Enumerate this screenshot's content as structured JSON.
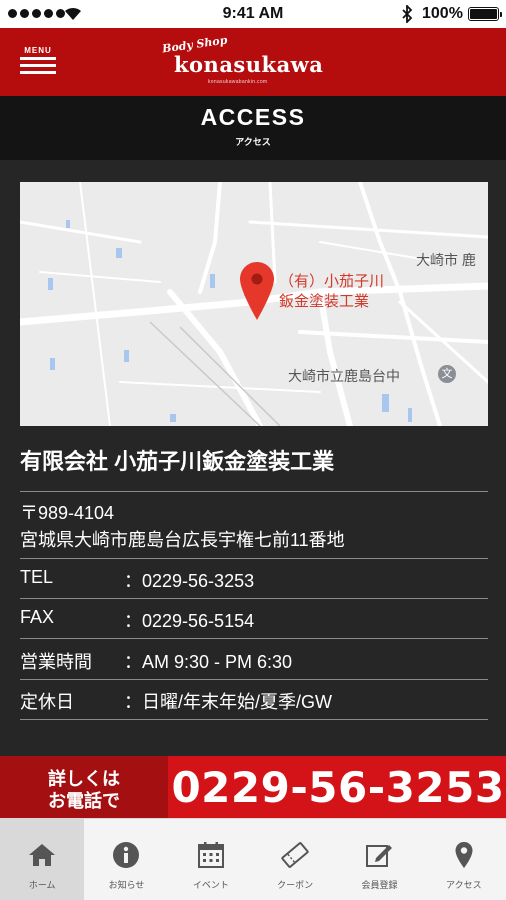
{
  "status_bar": {
    "time": "9:41 AM",
    "battery": "100%",
    "icons": [
      "signal-icon",
      "wifi-icon",
      "bluetooth-icon",
      "battery-icon"
    ]
  },
  "header": {
    "menu_label": "MENU",
    "logo_script": "Body Shop",
    "logo_name": "konasukawa",
    "logo_url": "konasukawabankin.com"
  },
  "page": {
    "title": "ACCESS",
    "subtitle": "アクセス"
  },
  "map": {
    "pin_label_line1": "（有）小茄子川",
    "pin_label_line2": "鈑金塗装工業",
    "place_1": "大崎市 鹿",
    "place_2": "大崎市立鹿島台中"
  },
  "company": {
    "name": "有限会社 小茄子川鈑金塗装工業",
    "postal": "〒989-4104",
    "address": "宮城県大崎市鹿島台広長宇権七前11番地",
    "rows": [
      {
        "label": "TEL",
        "value": "：0229-56-3253"
      },
      {
        "label": "FAX",
        "value": "：0229-56-5154"
      },
      {
        "label": "営業時間",
        "value": "：AM 9:30 - PM 6:30"
      },
      {
        "label": "定休日",
        "value": "：日曜/年末年始/夏季/GW"
      }
    ]
  },
  "phone_banner": {
    "cta_line1": "詳しくは",
    "cta_line2": "お電話で",
    "number": "0229-56-3253"
  },
  "bottom_nav": [
    {
      "label": "ホーム",
      "icon": "home-icon",
      "active": true
    },
    {
      "label": "お知らせ",
      "icon": "info-icon",
      "active": false
    },
    {
      "label": "イベント",
      "icon": "calendar-icon",
      "active": false
    },
    {
      "label": "クーポン",
      "icon": "coupon-icon",
      "active": false
    },
    {
      "label": "会員登録",
      "icon": "edit-icon",
      "active": false
    },
    {
      "label": "アクセス",
      "icon": "location-pin-icon",
      "active": false
    }
  ],
  "colors": {
    "header_red": "#b50c0e",
    "banner_red": "#d31317",
    "background": "#262626",
    "map_pin": "#e5382b"
  }
}
